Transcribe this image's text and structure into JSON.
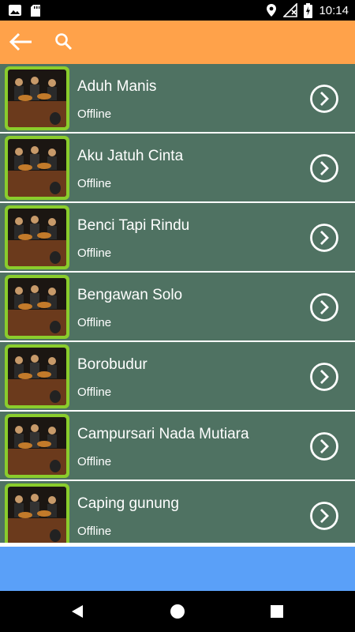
{
  "status_bar": {
    "time": "10:14",
    "icons": [
      "photo-icon",
      "sd-card-icon",
      "location-icon",
      "wifi-off-icon",
      "battery-charging-icon"
    ]
  },
  "app_bar": {
    "back_icon": "arrow-back-icon",
    "search_icon": "search-icon",
    "background": "#FFA24A"
  },
  "songs": [
    {
      "title": "Aduh Manis",
      "status": "Offline"
    },
    {
      "title": "Aku Jatuh Cinta",
      "status": "Offline"
    },
    {
      "title": "Benci Tapi Rindu",
      "status": "Offline"
    },
    {
      "title": "Bengawan Solo",
      "status": "Offline"
    },
    {
      "title": "Borobudur",
      "status": "Offline"
    },
    {
      "title": "Campursari Nada Mutiara",
      "status": "Offline"
    },
    {
      "title": "Caping gunung",
      "status": "Offline"
    }
  ],
  "colors": {
    "list_item_bg": "#4F7262",
    "thumb_border": "#8ACD2C",
    "banner_bg": "#5AA0F8"
  },
  "nav_bar": {
    "icons": [
      "back-triangle-icon",
      "home-circle-icon",
      "recents-square-icon"
    ]
  }
}
